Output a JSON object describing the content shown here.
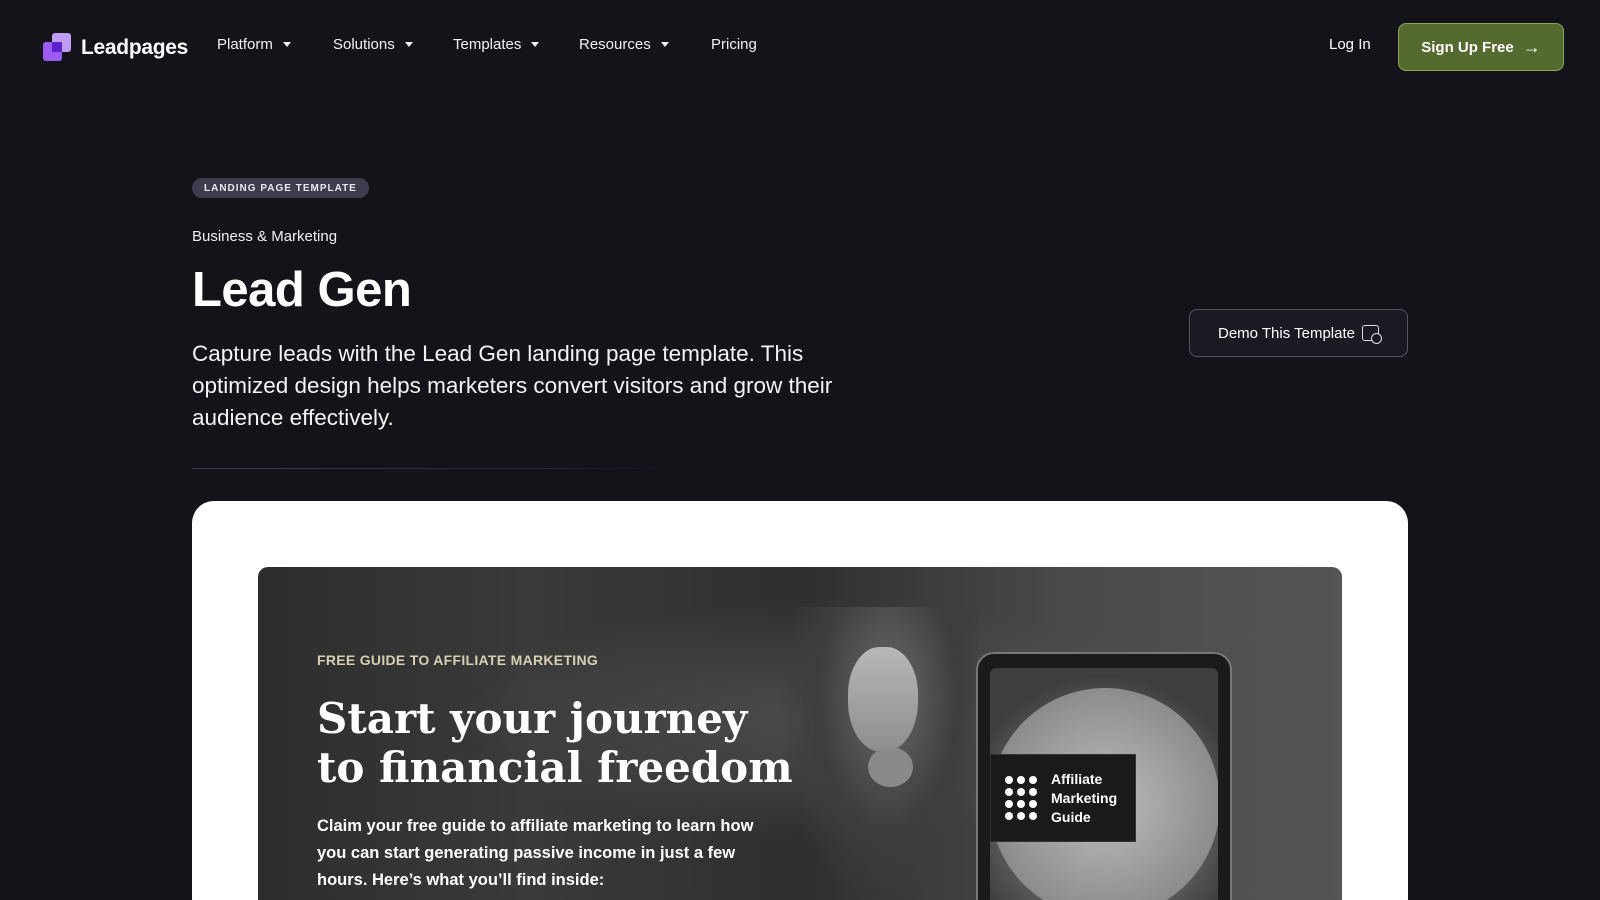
{
  "nav": {
    "brand": "Leadpages",
    "items": [
      {
        "label": "Platform",
        "has_dropdown": true
      },
      {
        "label": "Solutions",
        "has_dropdown": true
      },
      {
        "label": "Templates",
        "has_dropdown": true
      },
      {
        "label": "Resources",
        "has_dropdown": true
      },
      {
        "label": "Pricing",
        "has_dropdown": false
      }
    ],
    "login": "Log In",
    "signup": "Sign Up Free",
    "signup_icon": "arrow-right-icon"
  },
  "hero": {
    "badge": "LANDING PAGE TEMPLATE",
    "category": "Business & Marketing",
    "title": "Lead Gen",
    "description": "Capture leads with the Lead Gen landing page template. This optimized design helps marketers convert visitors and grow their audience effectively.",
    "demo_button": "Demo This Template",
    "demo_icon": "calendar-check-icon"
  },
  "preview": {
    "eyebrow": "FREE GUIDE TO AFFILIATE MARKETING",
    "headline": "Start your journey to financial freedom",
    "body": "Claim your free guide to affiliate marketing to learn how you can start generating passive income in just a few hours. Here’s what you’ll find inside:",
    "tablet_label_lines": [
      "Affiliate",
      "Marketing",
      "Guide"
    ]
  },
  "colors": {
    "background": "#14131a",
    "accent_signup": "#556a2f",
    "badge_bg": "#3f3d4d",
    "logo_purple": "#9a5cf2"
  }
}
